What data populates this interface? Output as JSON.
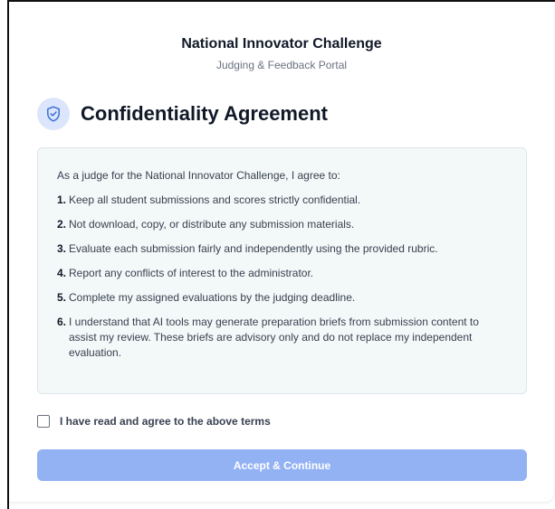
{
  "header": {
    "title": "National Innovator Challenge",
    "subtitle": "Judging & Feedback Portal"
  },
  "agreement": {
    "icon": "shield-check-icon",
    "title": "Confidentiality Agreement",
    "intro": "As a judge for the National Innovator Challenge, I agree to:",
    "items": [
      {
        "num": "1.",
        "text": "Keep all student submissions and scores strictly confidential."
      },
      {
        "num": "2.",
        "text": "Not download, copy, or distribute any submission materials."
      },
      {
        "num": "3.",
        "text": "Evaluate each submission fairly and independently using the provided rubric."
      },
      {
        "num": "4.",
        "text": "Report any conflicts of interest to the administrator."
      },
      {
        "num": "5.",
        "text": "Complete my assigned evaluations by the judging deadline."
      },
      {
        "num": "6.",
        "text": "I understand that AI tools may generate preparation briefs from submission content to assist my review. These briefs are advisory only and do not replace my independent evaluation."
      }
    ]
  },
  "consent": {
    "checked": false,
    "label": "I have read and agree to the above terms"
  },
  "actions": {
    "accept_label": "Accept & Continue"
  },
  "colors": {
    "accent_disabled": "#93b2f4",
    "icon_badge": "#dbe5fb",
    "icon_stroke": "#3b6fd4",
    "terms_background": "#f3f8f8"
  }
}
